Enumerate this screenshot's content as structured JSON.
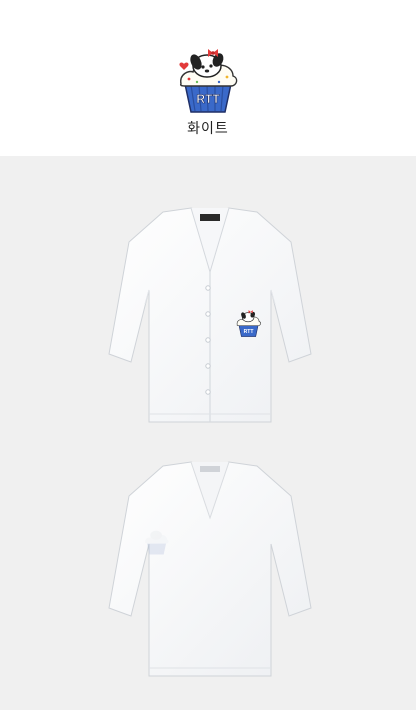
{
  "header": {
    "logo_icon": "cupcake-dog-logo-icon",
    "logo_text": "RTT",
    "color_name": "화이트"
  },
  "gallery": {
    "background": "#f0f0f0",
    "images": [
      {
        "name": "cardigan-front-image",
        "view": "front",
        "icon": "cardigan-front-icon"
      },
      {
        "name": "cardigan-back-image",
        "view": "back",
        "icon": "cardigan-back-icon"
      }
    ],
    "garment_color": "#ffffff",
    "accent_colors": {
      "cup_blue": "#3a69c9",
      "bow_red": "#e23a3a"
    }
  }
}
